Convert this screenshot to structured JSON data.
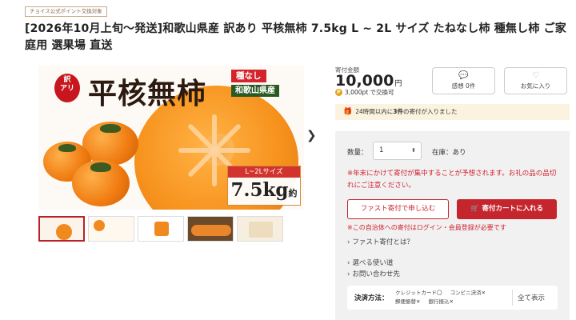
{
  "badge": "チョイス公式ポイント交換対象",
  "title": "[2026年10月上旬～発送]和歌山県産 訳あり 平核無柿 7.5kg L ~ 2L サイズ たねなし柿 種無し柿 ご家庭用 選果場 直送",
  "image": {
    "wake_main": "訳",
    "wake_sub": "アリ",
    "product_name": "平核無柿",
    "tag_seedless": "種なし",
    "tag_region": "和歌山県産",
    "size_label": "L~2Lサイズ",
    "weight_label": "7.5kg",
    "weight_prefix": "約"
  },
  "donation": {
    "label": "寄付金額",
    "amount": "10,000",
    "currency": "円",
    "points_icon": "P",
    "points": "3,000pt で交換可"
  },
  "impression": {
    "icon": "speech-bubble-icon",
    "label": "感想 0件"
  },
  "favorite": {
    "icon": "heart-icon",
    "label": "お気に入り"
  },
  "recent": {
    "text_pre": "24時間以内に",
    "count": "3件",
    "text_post": "の寄付が入りました"
  },
  "order": {
    "qty_label": "数量：",
    "qty_value": "1",
    "stock": "在庫：あり",
    "notice": "※年末にかけて寄付が集中することが予想されます。お礼の品の品切れにご注意ください。",
    "fast_button": "ファスト寄付で申し込む",
    "cart_button": "寄付カートに入れる",
    "login_note": "※この自治体への寄付はログイン・会員登録が必要です",
    "link_fast": "ファスト寄付とは？",
    "link_usage": "選べる使い道",
    "link_contact": "お問い合わせ先"
  },
  "payment": {
    "label": "決済方法：",
    "methods": [
      "クレジットカード〇",
      "コンビニ決済✕",
      "郵便振替✕",
      "銀行振込✕"
    ],
    "show_all": "全て表示"
  },
  "colors": {
    "accent_red": "#c5252c",
    "notice_red": "#d0202e",
    "link_blue": "#1d4e9a",
    "banner_bg": "#fbf3df"
  }
}
